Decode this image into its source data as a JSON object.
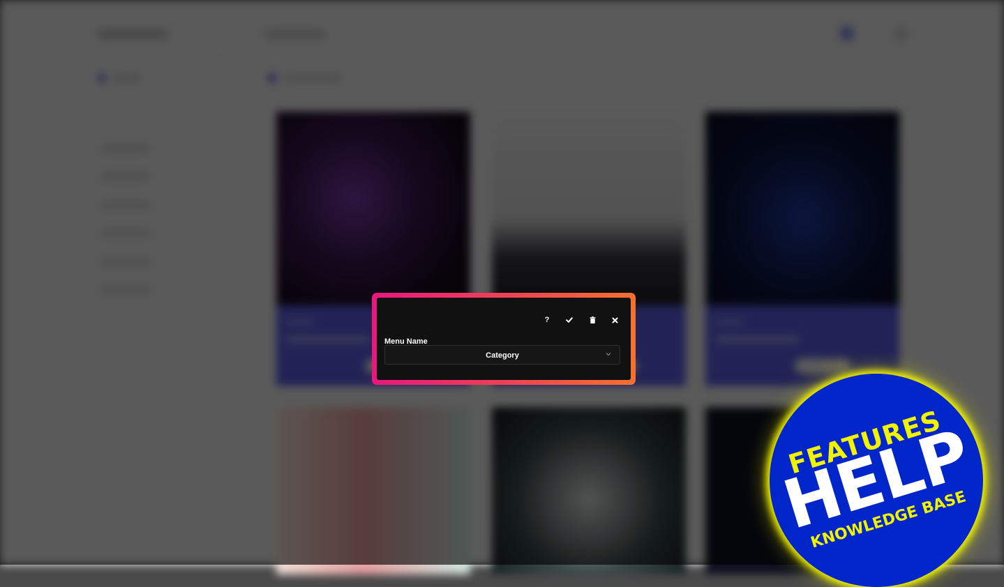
{
  "dialog": {
    "toolbar": {
      "help_icon": "question-mark-icon",
      "confirm_icon": "check-icon",
      "delete_icon": "trash-icon",
      "close_icon": "close-icon"
    },
    "menu_name_label": "Menu Name",
    "menu_select_value": "Category",
    "chevron_icon": "chevron-down-icon"
  },
  "badge": {
    "line1": "FEATURES",
    "line2": "HELP",
    "line3": "KNOWLEDGE BASE"
  },
  "colors": {
    "frame_gradient_start": "#e8177e",
    "frame_gradient_end": "#f47130",
    "badge_background": "#0025c8",
    "badge_accent": "#f1f300",
    "background_card_accent": "#5b5be0"
  }
}
